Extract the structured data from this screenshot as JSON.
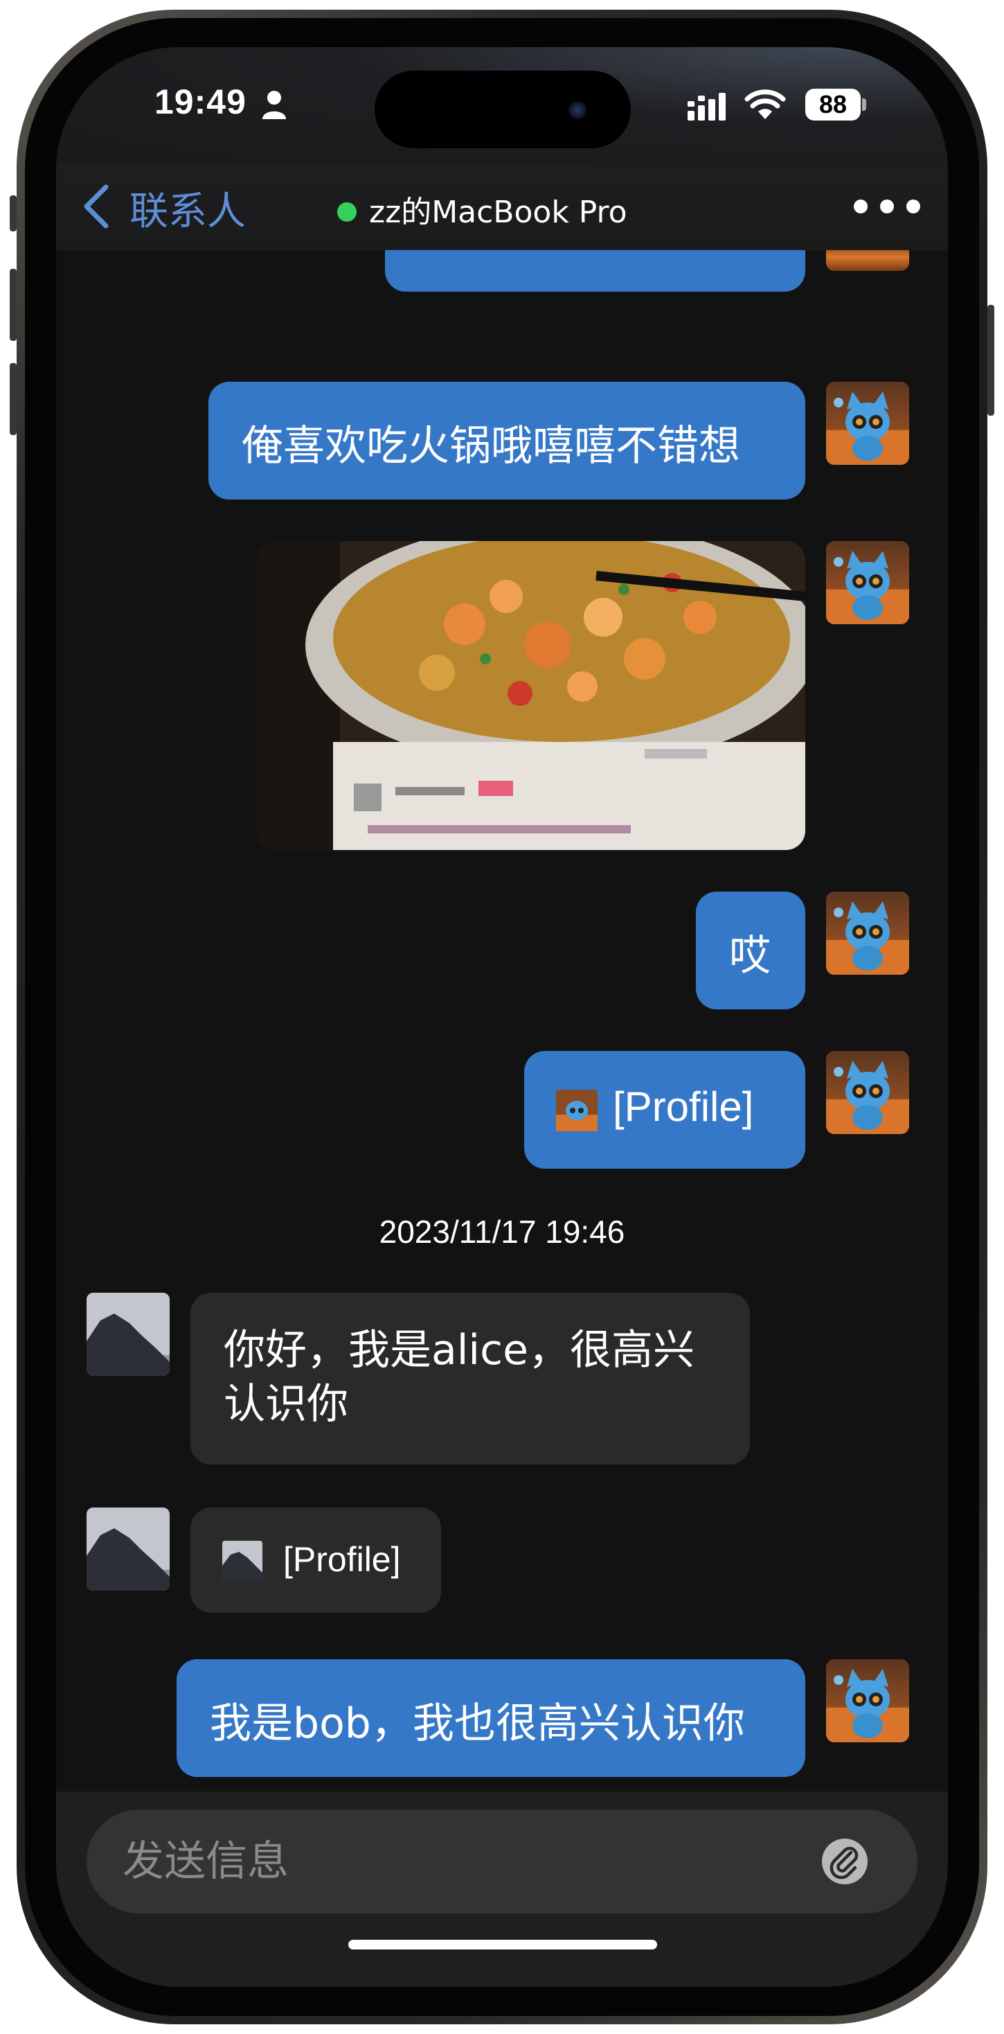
{
  "status_bar": {
    "time": "19:49",
    "battery": "88",
    "icons": [
      "person-icon",
      "signal-icon",
      "wifi-icon",
      "battery-icon"
    ]
  },
  "nav": {
    "back_label": "联系人",
    "title": "zz的MacBook Pro",
    "online_color": "#35d25a",
    "icons": [
      "chevron-left-icon",
      "more-icon"
    ]
  },
  "messages": [
    {
      "from": "me",
      "type": "text",
      "text": "俺喜欢吃火锅哦嘻嘻不错想"
    },
    {
      "from": "me",
      "type": "image"
    },
    {
      "from": "me",
      "type": "text",
      "text": "哎"
    },
    {
      "from": "me",
      "type": "profile",
      "text": "[Profile]"
    },
    {
      "from": "them",
      "type": "text",
      "lines": [
        "你好，我是alice，很高兴",
        "认识你"
      ]
    },
    {
      "from": "them",
      "type": "profile",
      "text": "[Profile]"
    },
    {
      "from": "me",
      "type": "text",
      "text": "我是bob，我也很高兴认识你"
    }
  ],
  "timestamp": "2023/11/17 19:46",
  "input": {
    "placeholder": "发送信息",
    "icon": "paperclip-icon"
  },
  "colors": {
    "outgoing_bubble": "#3678c8",
    "incoming_bubble": "#2a2a2b",
    "accent": "#5d8fd6"
  }
}
